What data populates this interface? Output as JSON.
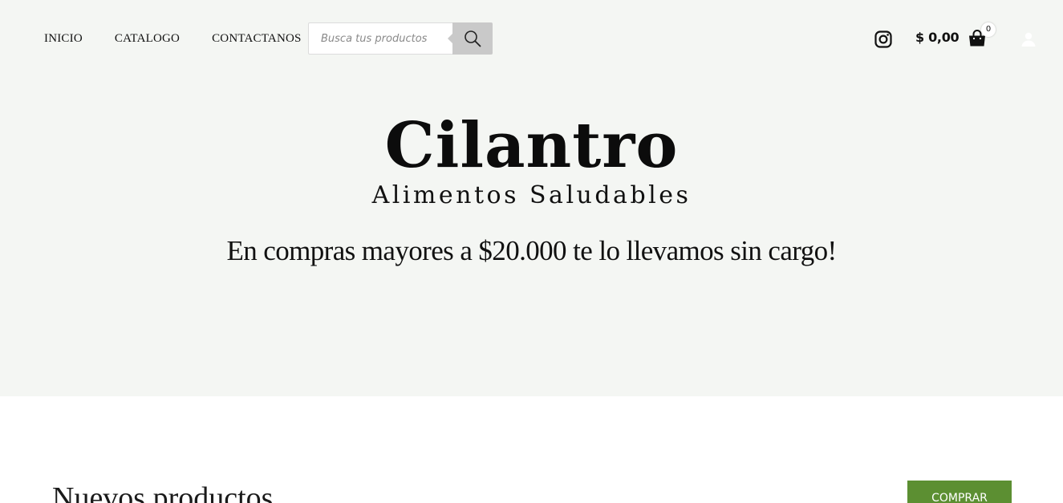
{
  "header": {
    "nav": [
      {
        "label": "INICIO"
      },
      {
        "label": "CATALOGO"
      },
      {
        "label": "CONTACTANOS"
      }
    ],
    "search": {
      "placeholder": "Busca tus productos",
      "value": "",
      "button_icon": "search-icon"
    },
    "social_icon": "instagram-icon",
    "cart": {
      "total": "$ 0,00",
      "count": "0",
      "icon": "shopping-bag-icon"
    },
    "account_icon": "user-icon"
  },
  "hero": {
    "brand": "Cilantro",
    "tagline": "Alimentos Saludables",
    "promo": "En compras mayores a $20.000 te lo llevamos sin cargo!"
  },
  "products_section": {
    "title": "Nuevos productos",
    "button_label": "COMPRAR"
  },
  "colors": {
    "hero_background": "#f4f6f3",
    "search_button": "#c9c9c9",
    "accent_green": "#5c8f32",
    "text": "#111111"
  }
}
